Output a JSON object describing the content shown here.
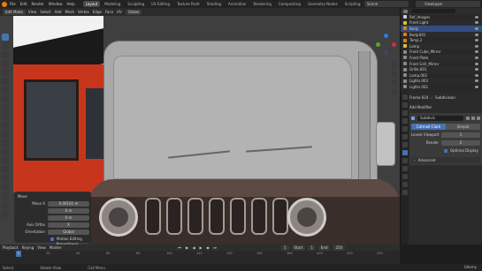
{
  "app": {
    "menus": [
      "File",
      "Edit",
      "Render",
      "Window",
      "Help"
    ],
    "workspace_tabs": [
      "Layout",
      "Modeling",
      "Sculpting",
      "UV Editing",
      "Texture Paint",
      "Shading",
      "Animation",
      "Rendering",
      "Compositing",
      "Geometry Nodes",
      "Scripting"
    ],
    "active_workspace": "Layout",
    "scene": "Scene",
    "view_layer": "ViewLayer"
  },
  "viewport_header": {
    "mode": "Edit Mode",
    "menus": [
      "View",
      "Select",
      "Add",
      "Mesh",
      "Vertex",
      "Edge",
      "Face",
      "UV"
    ],
    "transform_orientation": "Global"
  },
  "operator_panel": {
    "title": "Move",
    "move_x_label": "Move X",
    "move_x_value": "0.00161 m",
    "y_value": "0 m",
    "z_value": "0 m",
    "axis_ortho_label": "Axis Ortho",
    "axis_ortho_value": "X",
    "orientation_label": "Orientation",
    "orientation_value": "Global",
    "proportional_label": "Proportional Editing",
    "option_label": "Motion Editing"
  },
  "timeline": {
    "menus": [
      "Playback",
      "Keying",
      "View",
      "Marker"
    ],
    "current_frame": "1",
    "start_label": "Start",
    "start_value": "1",
    "end_label": "End",
    "end_value": "250",
    "ticks": [
      "0",
      "20",
      "40",
      "60",
      "80",
      "100",
      "120",
      "140",
      "160",
      "180",
      "200",
      "220",
      "240"
    ]
  },
  "status_bar": {
    "items": [
      "Select",
      "Rotate View",
      "Call Menu"
    ],
    "watermark": "Udemy"
  },
  "outliner": {
    "items": [
      {
        "name": "Ref_Images",
        "color": "#cfcfcf",
        "selected": false
      },
      {
        "name": "Front Light",
        "color": "#d4c43a",
        "selected": false
      },
      {
        "name": "Body",
        "color": "#e87d0d",
        "selected": true
      },
      {
        "name": "Body.001",
        "color": "#e87d0d",
        "selected": false
      },
      {
        "name": "Temp.2",
        "color": "#e87d0d",
        "selected": false
      },
      {
        "name": "Lamp",
        "color": "#d4c43a",
        "selected": false
      },
      {
        "name": "Front Cube_Mirror",
        "color": "#8a8a8a",
        "selected": false
      },
      {
        "name": "Front Plate",
        "color": "#8a8a8a",
        "selected": false
      },
      {
        "name": "Front Grill_Mirror",
        "color": "#8a8a8a",
        "selected": false
      },
      {
        "name": "Grille.001",
        "color": "#8a8a8a",
        "selected": false
      },
      {
        "name": "Lamp.002",
        "color": "#8a8a8a",
        "selected": false
      },
      {
        "name": "Lights.003",
        "color": "#8a8a8a",
        "selected": false
      },
      {
        "name": "Lights.002",
        "color": "#8a8a8a",
        "selected": false
      }
    ]
  },
  "properties": {
    "object_name": "Frame.024",
    "modifier_label": "Subdivision",
    "add_modifier": "Add Modifier",
    "modifier_name": "Subdivis",
    "method_options": [
      "Catmull-Clark",
      "Simple"
    ],
    "active_method": "Catmull-Clark",
    "levels_viewport_label": "Levels Viewport",
    "levels_viewport_value": "1",
    "render_label": "Render",
    "render_value": "2",
    "optimal_display_label": "Optimal Display",
    "advanced_label": "Advanced"
  }
}
